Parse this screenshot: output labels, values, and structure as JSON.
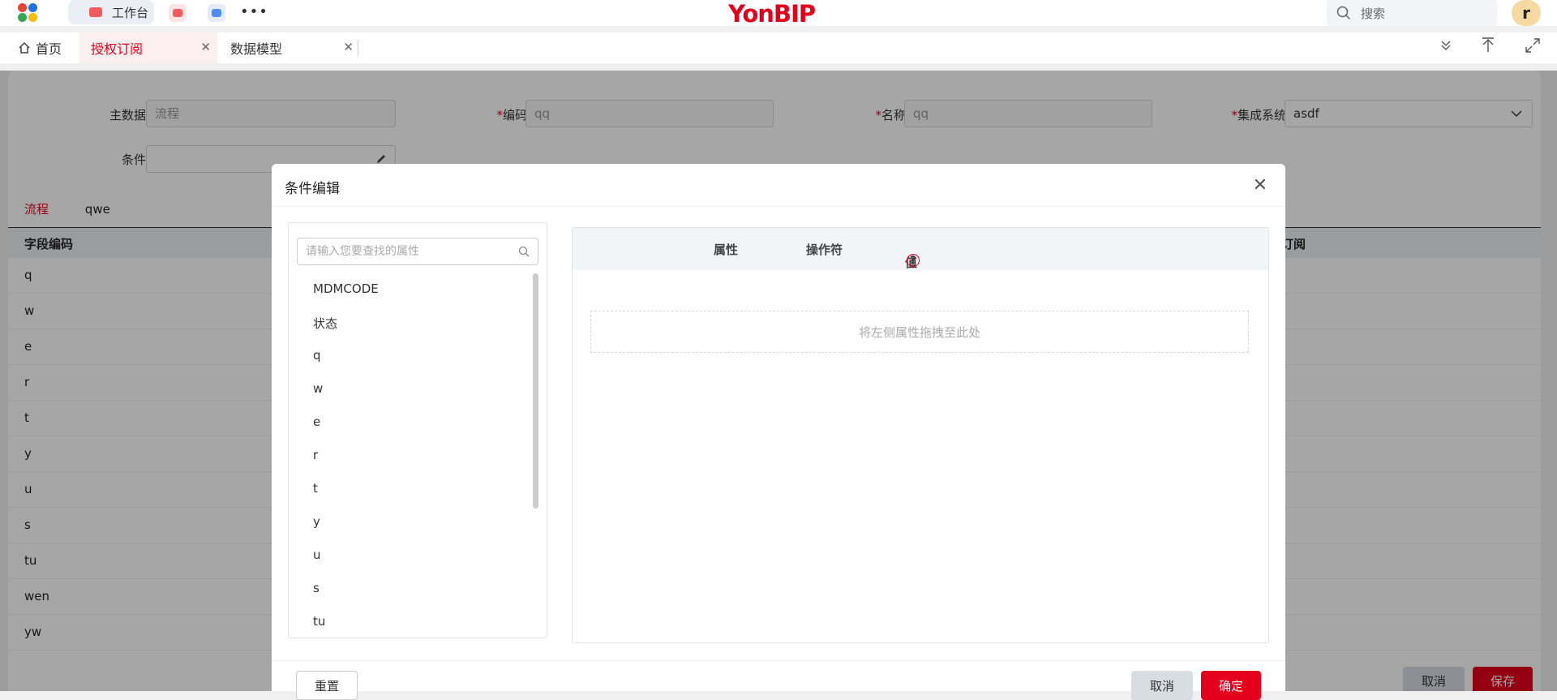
{
  "topbar": {
    "brand": "YonBIP",
    "workbench_label": "工作台",
    "search_placeholder": "搜索",
    "avatar_letter": "r"
  },
  "tabs": {
    "home": "首页",
    "active": "授权订阅",
    "data_model": "数据模型"
  },
  "form": {
    "master_data_label": "主数据",
    "master_data_value": "流程",
    "code_label": "编码",
    "code_value": "qq",
    "name_label": "名称",
    "name_value": "qq",
    "system_label": "集成系统",
    "system_value": "asdf",
    "condition_label": "条件",
    "required_mark": "*"
  },
  "side_tabs": [
    "流程",
    "qwe"
  ],
  "table": {
    "col_field_code": "字段编码",
    "col_subscribe": "订阅",
    "rows": [
      "q",
      "w",
      "e",
      "r",
      "t",
      "y",
      "u",
      "s",
      "tu",
      "wen",
      "yw"
    ]
  },
  "page_buttons": {
    "cancel": "取消",
    "save": "保存"
  },
  "dialog": {
    "title": "条件编辑",
    "search_placeholder": "请输入您要查找的属性",
    "attributes": [
      "MDMCODE",
      "状态",
      "q",
      "w",
      "e",
      "r",
      "t",
      "y",
      "u",
      "s",
      "tu"
    ],
    "header_attr": "属性",
    "header_op": "操作符",
    "header_value": "值",
    "help_mark": "?",
    "drop_hint": "将左侧属性拖拽至此处",
    "reset": "重置",
    "cancel": "取消",
    "confirm": "确定"
  },
  "colors": {
    "brand_red": "#e4001c",
    "muted_text": "#aaaaaa"
  }
}
